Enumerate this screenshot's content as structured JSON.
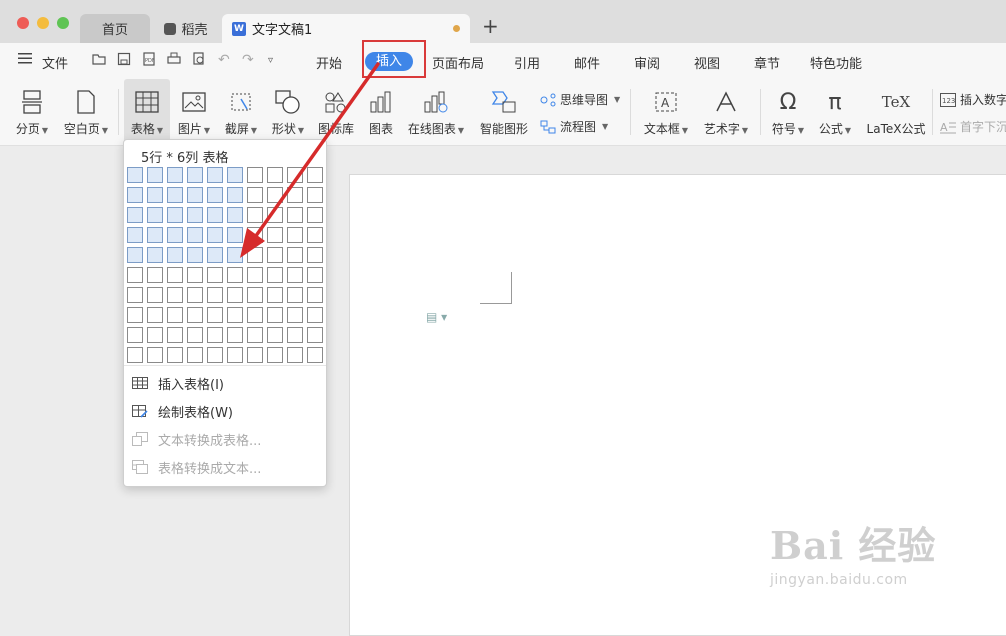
{
  "window": {
    "tabs": [
      {
        "label": "首页"
      },
      {
        "label": "稻壳"
      },
      {
        "label": "文字文稿1"
      }
    ],
    "new_tab": "+"
  },
  "menubar": {
    "file": "文件",
    "items": [
      "开始",
      "插入",
      "页面布局",
      "引用",
      "邮件",
      "审阅",
      "视图",
      "章节",
      "特色功能"
    ],
    "active": "插入"
  },
  "ribbon": {
    "tools": [
      "分页",
      "空白页",
      "表格",
      "图片",
      "截屏",
      "形状",
      "图标库",
      "图表",
      "在线图表",
      "智能图形",
      "文本框",
      "艺术字",
      "符号",
      "公式",
      "LaTeX公式"
    ],
    "mindmap": "思维导图",
    "flowchart": "流程图",
    "insert_number": "插入数字",
    "drop_cap": "首字下沉"
  },
  "table_dropdown": {
    "title": "5行 * 6列 表格",
    "rows": 10,
    "cols": 10,
    "selected_rows": 5,
    "selected_cols": 6,
    "items": [
      {
        "label": "插入表格(I)",
        "enabled": true,
        "icon": "table-icon"
      },
      {
        "label": "绘制表格(W)",
        "enabled": true,
        "icon": "draw-table-icon"
      },
      {
        "label": "文本转换成表格...",
        "enabled": false,
        "icon": "text-to-table-icon"
      },
      {
        "label": "表格转换成文本...",
        "enabled": false,
        "icon": "table-to-text-icon"
      }
    ]
  },
  "watermark": {
    "main": "Bai 经验",
    "sub": "jingyan.baidu.com"
  },
  "colors": {
    "accent": "#3f86e8",
    "highlight_box": "#d93a3a",
    "arrow": "#d62b2b",
    "selected_cell": "#dde9f8"
  }
}
